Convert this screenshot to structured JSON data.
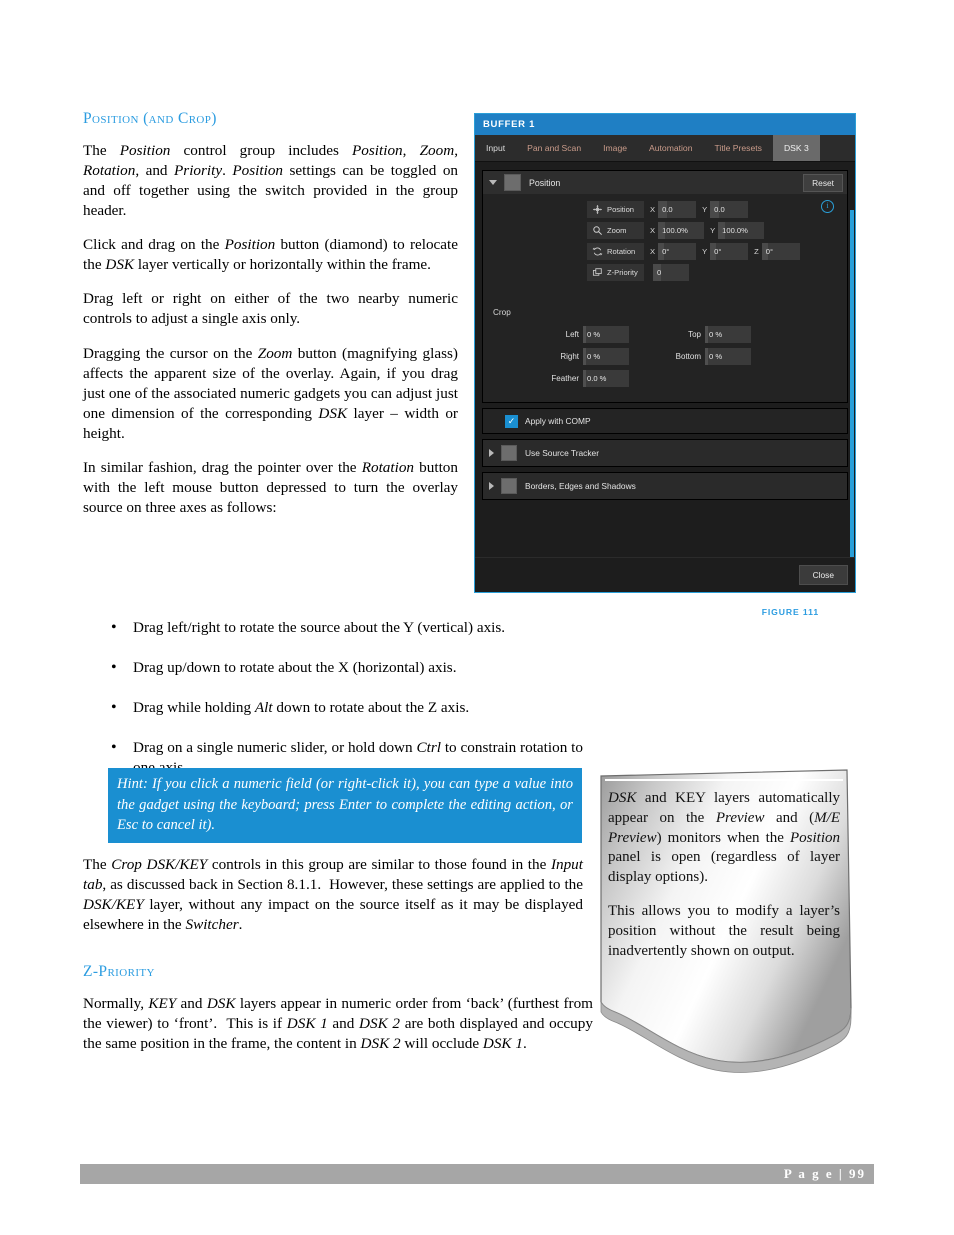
{
  "document": {
    "section_heading": "Position (and Crop)",
    "paragraphs": [
      "The <em>Position</em> control group includes <em>Position</em>, <em>Zoom</em>, <em>Rotation</em>, and <em>Priority</em>. <em>Position</em> settings can be toggled on and off together using the switch provided in the group header.",
      "Click and drag on the <em>Position</em> button (diamond) to relocate the <em>DSK</em> layer vertically or horizontally within the frame.",
      "Drag left or right on either of the two nearby numeric controls to adjust a single axis only.",
      "Dragging the cursor on the <em>Zoom</em> button (magnifying glass) affects the apparent size of the overlay. Again, if you drag just one of the associated numeric gadgets you can adjust just one dimension of the corresponding <em>DSK</em> layer &ndash; width or height.",
      "In similar fashion, drag the pointer over the <em>Rotation</em> button with the left mouse button depressed to turn the overlay source on three axes as follows:"
    ],
    "bullets": [
      "Drag left/right to rotate the source about the Y (vertical) axis.",
      "Drag up/down to rotate about the X (horizontal) axis.",
      "Drag while holding <em>Alt</em> down to rotate about the Z axis.",
      "Drag on a single numeric slider, or hold down <em>Ctrl</em> to constrain rotation to one axis."
    ],
    "hint": "Hint: If you click a numeric field (or right-click it), you can type a value into the gadget using the keyboard; press Enter to complete the editing action, or Esc to cancel it).",
    "paragraph_after_hint": "The <em>Crop DSK/KEY</em> controls in this group are similar to those found in the <em>Input tab</em>, as discussed back in Section 8.1.1.&nbsp; However, these settings are applied to the <em>DSK/KEY</em> layer, without any impact on the source itself as it may be displayed elsewhere in the <em>Switcher</em>.",
    "z_priority_heading": "Z-Priority",
    "z_priority_paragraph": "Normally, <em>KEY</em> and <em>DSK</em> layers appear in numeric order from &lsquo;back&rsquo; (furthest from the viewer) to &lsquo;front&rsquo;.&nbsp; This is if <em>DSK 1</em> and <em>DSK 2</em> are both displayed and occupy the same position in the frame, the content in <em>DSK 2</em> will occlude <em>DSK 1</em>.",
    "figure_caption": "FIGURE 111",
    "footer_page": "P a g e | 99"
  },
  "callout": {
    "paragraphs": [
      "<em>DSK</em> and KEY layers automatically appear on the <em>Preview</em> and (<em>M/E Preview</em>) monitors when the <em>Position</em> panel is open (regardless of layer display options).",
      "This allows you to modify a layer&rsquo;s position without the result being inadvertently shown on output."
    ]
  },
  "screenshot": {
    "window_title": "BUFFER 1",
    "tabs": [
      {
        "label": "Input",
        "active": false
      },
      {
        "label": "Pan and Scan",
        "active": false
      },
      {
        "label": "Image",
        "active": false
      },
      {
        "label": "Automation",
        "active": false
      },
      {
        "label": "Title Presets",
        "active": false
      },
      {
        "label": "DSK 3",
        "active": true
      }
    ],
    "position_group": {
      "label": "Position",
      "reset_label": "Reset",
      "info_glyph": "i",
      "controls": [
        {
          "name": "Position",
          "icon": "move-cross-icon",
          "fields": [
            {
              "axis": "X",
              "value": "0.0"
            },
            {
              "axis": "Y",
              "value": "0.0"
            }
          ]
        },
        {
          "name": "Zoom",
          "icon": "magnifier-icon",
          "fields": [
            {
              "axis": "X",
              "value": "100.0%"
            },
            {
              "axis": "Y",
              "value": "100.0%"
            }
          ]
        },
        {
          "name": "Rotation",
          "icon": "rotate-icon",
          "fields": [
            {
              "axis": "X",
              "value": "0°"
            },
            {
              "axis": "Y",
              "value": "0°"
            },
            {
              "axis": "Z",
              "value": "0°"
            }
          ]
        },
        {
          "name": "Z-Priority",
          "icon": "layers-icon",
          "fields": [
            {
              "axis": "",
              "value": "0"
            }
          ]
        }
      ]
    },
    "crop_group": {
      "title": "Crop",
      "rows": [
        {
          "left_label": "Left",
          "left_value": "0 %",
          "right_label": "Top",
          "right_value": "0 %"
        },
        {
          "left_label": "Right",
          "left_value": "0 %",
          "right_label": "Bottom",
          "right_value": "0 %"
        },
        {
          "left_label": "Feather",
          "left_value": "0.0 %",
          "right_label": "",
          "right_value": ""
        }
      ]
    },
    "apply_with_comp": {
      "label": "Apply with COMP",
      "checked": true,
      "check_glyph": "✓"
    },
    "collapsed_rows": [
      {
        "label": "Use Source Tracker"
      },
      {
        "label": "Borders, Edges and Shadows"
      }
    ],
    "close_label": "Close"
  },
  "colors": {
    "accent_blue": "#2b9ce0",
    "title_blue": "#1f7fc4",
    "hint_blue": "#1a8fd1",
    "panel_dark": "#1d1d1d",
    "footer_gray": "#a6a6a6"
  }
}
